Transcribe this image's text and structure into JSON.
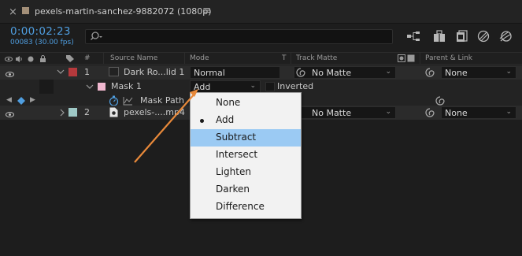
{
  "tab": {
    "close": "×",
    "title": "pexels-martin-sanchez-9882072 (1080p)",
    "menu": "≡",
    "label_color": "#a38f78"
  },
  "time": {
    "timecode": "0:00:02:23",
    "frame_info": "00083 (30.00 fps)"
  },
  "search": {
    "placeholder": "",
    "icon": "search-icon"
  },
  "toolbar_icons": [
    "comp-flowchart-icon",
    "draft-3d-icon",
    "shy-layers-icon",
    "frame-blending-icon",
    "motion-blur-icon"
  ],
  "columns": {
    "number": "#",
    "source_name": "Source Name",
    "mode": "Mode",
    "t": "T",
    "track_matte": "Track Matte",
    "parent_link": "Parent & Link"
  },
  "layers": [
    {
      "number": "1",
      "name": "Dark Ro...lid 1",
      "mode": "Normal",
      "track_matte": "No Matte",
      "parent": "None",
      "label_color": "#b5393c"
    },
    {
      "number": "2",
      "name": "pexels-....mp4",
      "mode": "",
      "track_matte": "No Matte",
      "parent": "None",
      "label_color": "#9ec8c6"
    }
  ],
  "mask": {
    "name": "Mask 1",
    "mode": "Add",
    "inverted_label": "Inverted",
    "color": "#f0b7cf",
    "path_label": "Mask Path"
  },
  "mode_menu": {
    "items": [
      "None",
      "Add",
      "Subtract",
      "Intersect",
      "Lighten",
      "Darken",
      "Difference"
    ],
    "selected": "Add",
    "hovered": "Subtract"
  },
  "colors": {
    "accent_blue": "#4f9ee0",
    "annotation_arrow": "#e8893a",
    "menu_hover": "#9bcaf3"
  }
}
